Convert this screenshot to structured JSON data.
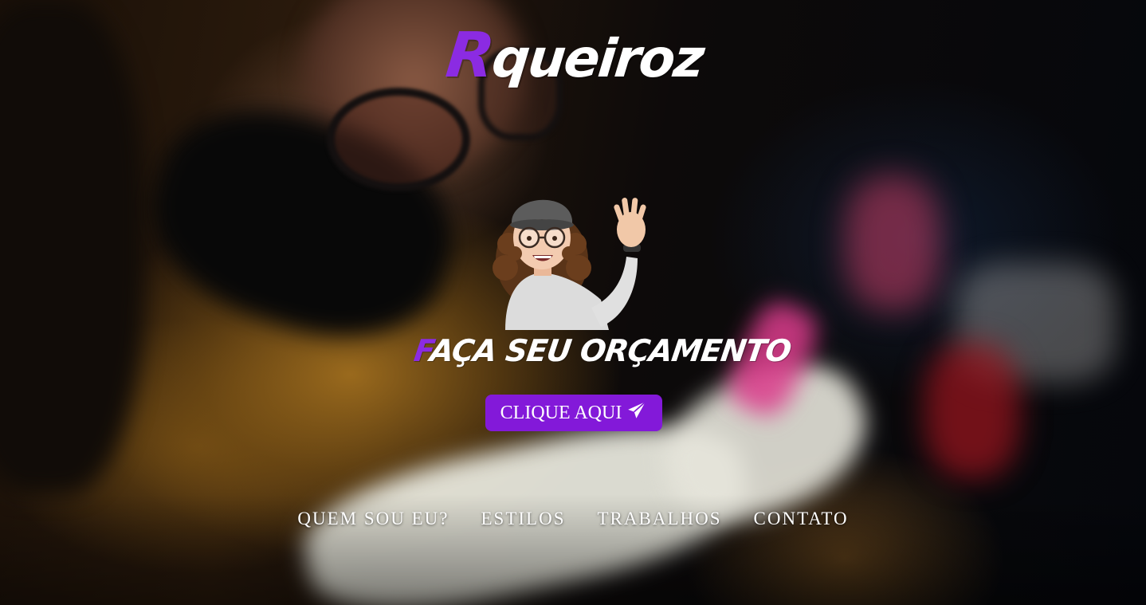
{
  "brand": {
    "initial": "R",
    "rest": "queiroz"
  },
  "avatar": {
    "icon": "waving-memoji-avatar"
  },
  "headline": {
    "initial": "F",
    "rest": "AÇA SEU ORÇAMENTO"
  },
  "cta": {
    "label": "CLIQUE AQUI",
    "icon": "paper-plane-icon"
  },
  "nav": {
    "items": [
      {
        "label": "QUEM SOU EU?"
      },
      {
        "label": "ESTILOS"
      },
      {
        "label": "TRABALHOS"
      },
      {
        "label": "CONTATO"
      }
    ]
  },
  "colors": {
    "accent": "#8319d9",
    "brand_initial": "#8b2be2",
    "text": "#ffffff"
  }
}
